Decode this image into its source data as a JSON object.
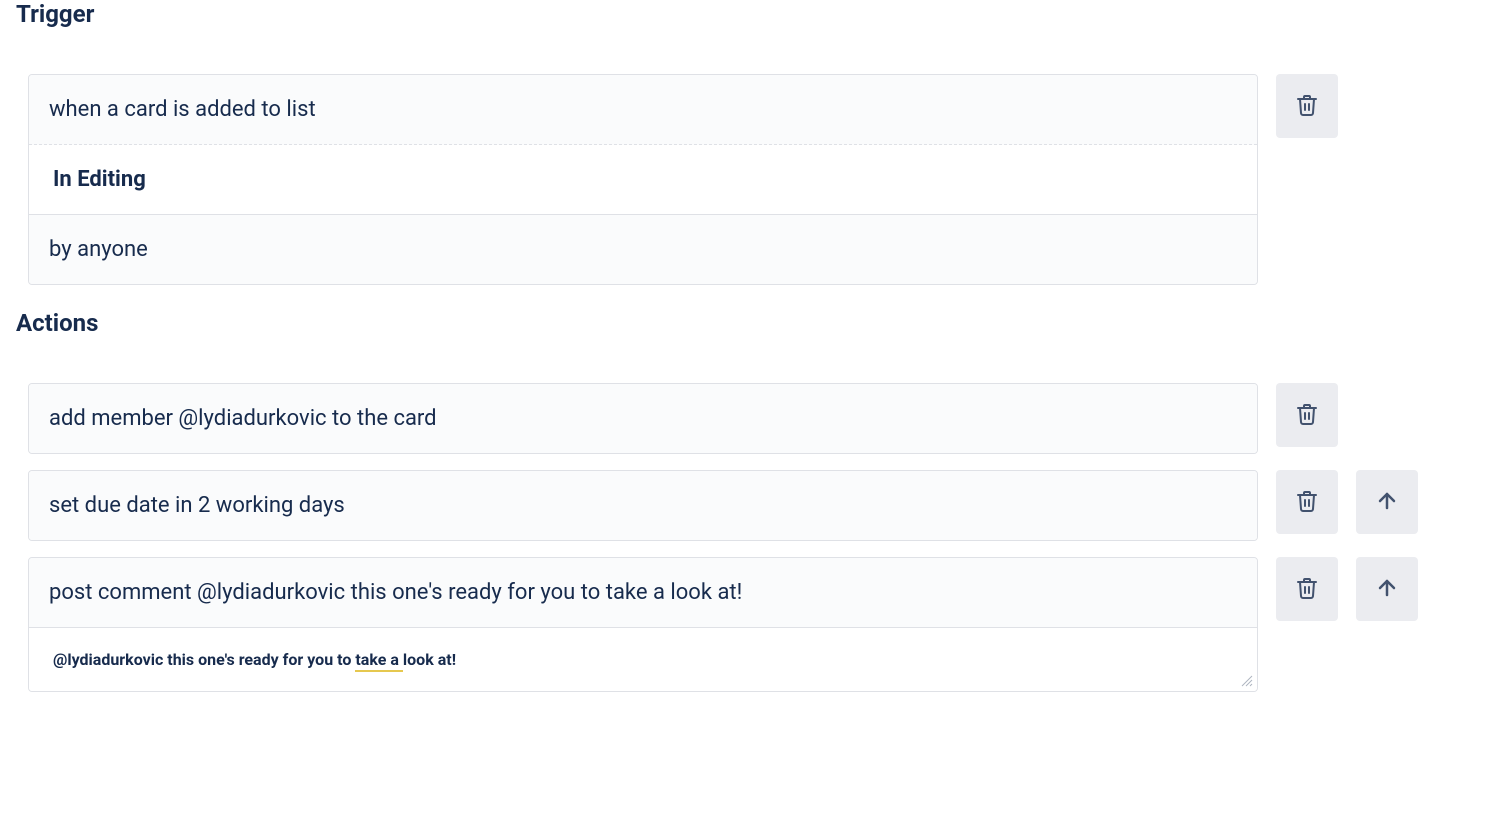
{
  "sections": {
    "trigger_title": "Trigger",
    "actions_title": "Actions"
  },
  "trigger": {
    "condition": "when a card is added to list",
    "list_name": "In Editing",
    "by_whom": "by anyone"
  },
  "actions": [
    {
      "text": "add member @lydiadurkovic to the card",
      "has_up": false
    },
    {
      "text": "set due date in 2 working days",
      "has_up": true
    },
    {
      "text": "post comment @lydiadurkovic this one's ready for you to take a look at!",
      "has_up": true,
      "comment_prefix": "@lydiadurkovic this one's ready for you to ",
      "comment_underlined": "take a ",
      "comment_suffix": "look at!"
    }
  ]
}
